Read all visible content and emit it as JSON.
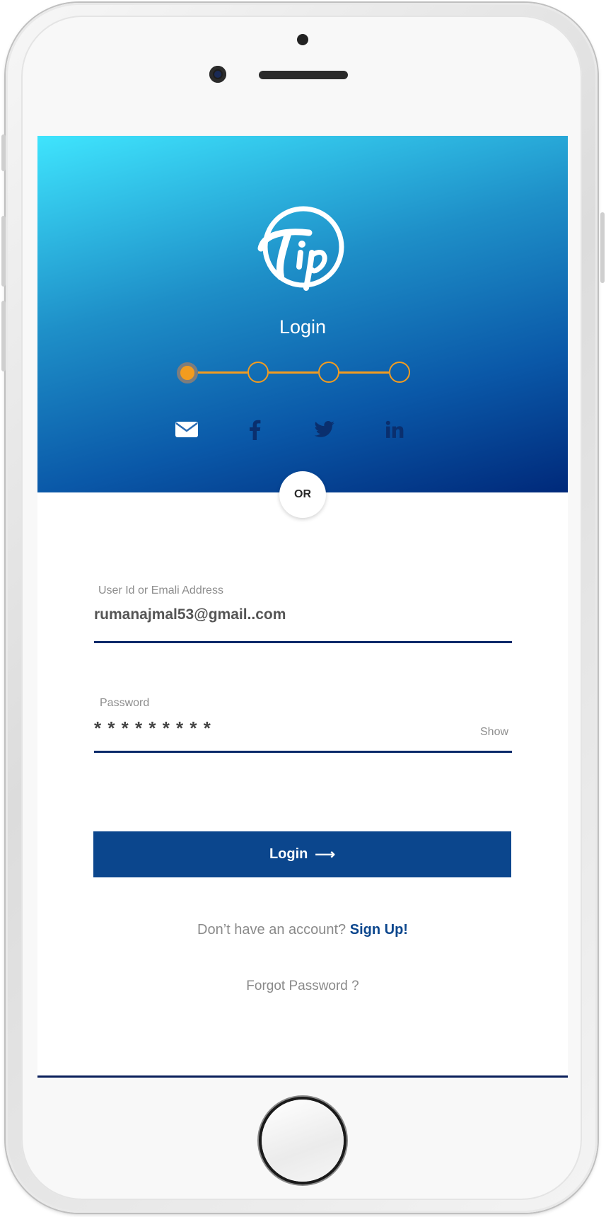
{
  "header": {
    "title": "Login",
    "logo_text": "Tip",
    "colors": {
      "gradient_top": "#3fe4fd",
      "gradient_bottom": "#00297a",
      "accent": "#f39c1f"
    }
  },
  "stepper": {
    "total_steps": 4,
    "current_step": 1
  },
  "social": [
    {
      "name": "email",
      "icon": "envelope-icon"
    },
    {
      "name": "facebook",
      "icon": "facebook-icon"
    },
    {
      "name": "twitter",
      "icon": "twitter-icon"
    },
    {
      "name": "linkedin",
      "icon": "linkedin-icon"
    }
  ],
  "divider_text": "OR",
  "form": {
    "user_label": "User Id or Emali Address",
    "user_value": "rumanajmal53@gmail..com",
    "password_label": "Password",
    "password_value": "* * * * * * * * *",
    "show_label": "Show"
  },
  "login_button": {
    "label": "Login",
    "arrow": "⟶"
  },
  "signup": {
    "prompt": "Don’t have an account?",
    "link": "Sign Up!"
  },
  "forgot_password": "Forgot Password ?",
  "brand_colors": {
    "button": "#0b468d",
    "underline": "#0a2a6a"
  }
}
